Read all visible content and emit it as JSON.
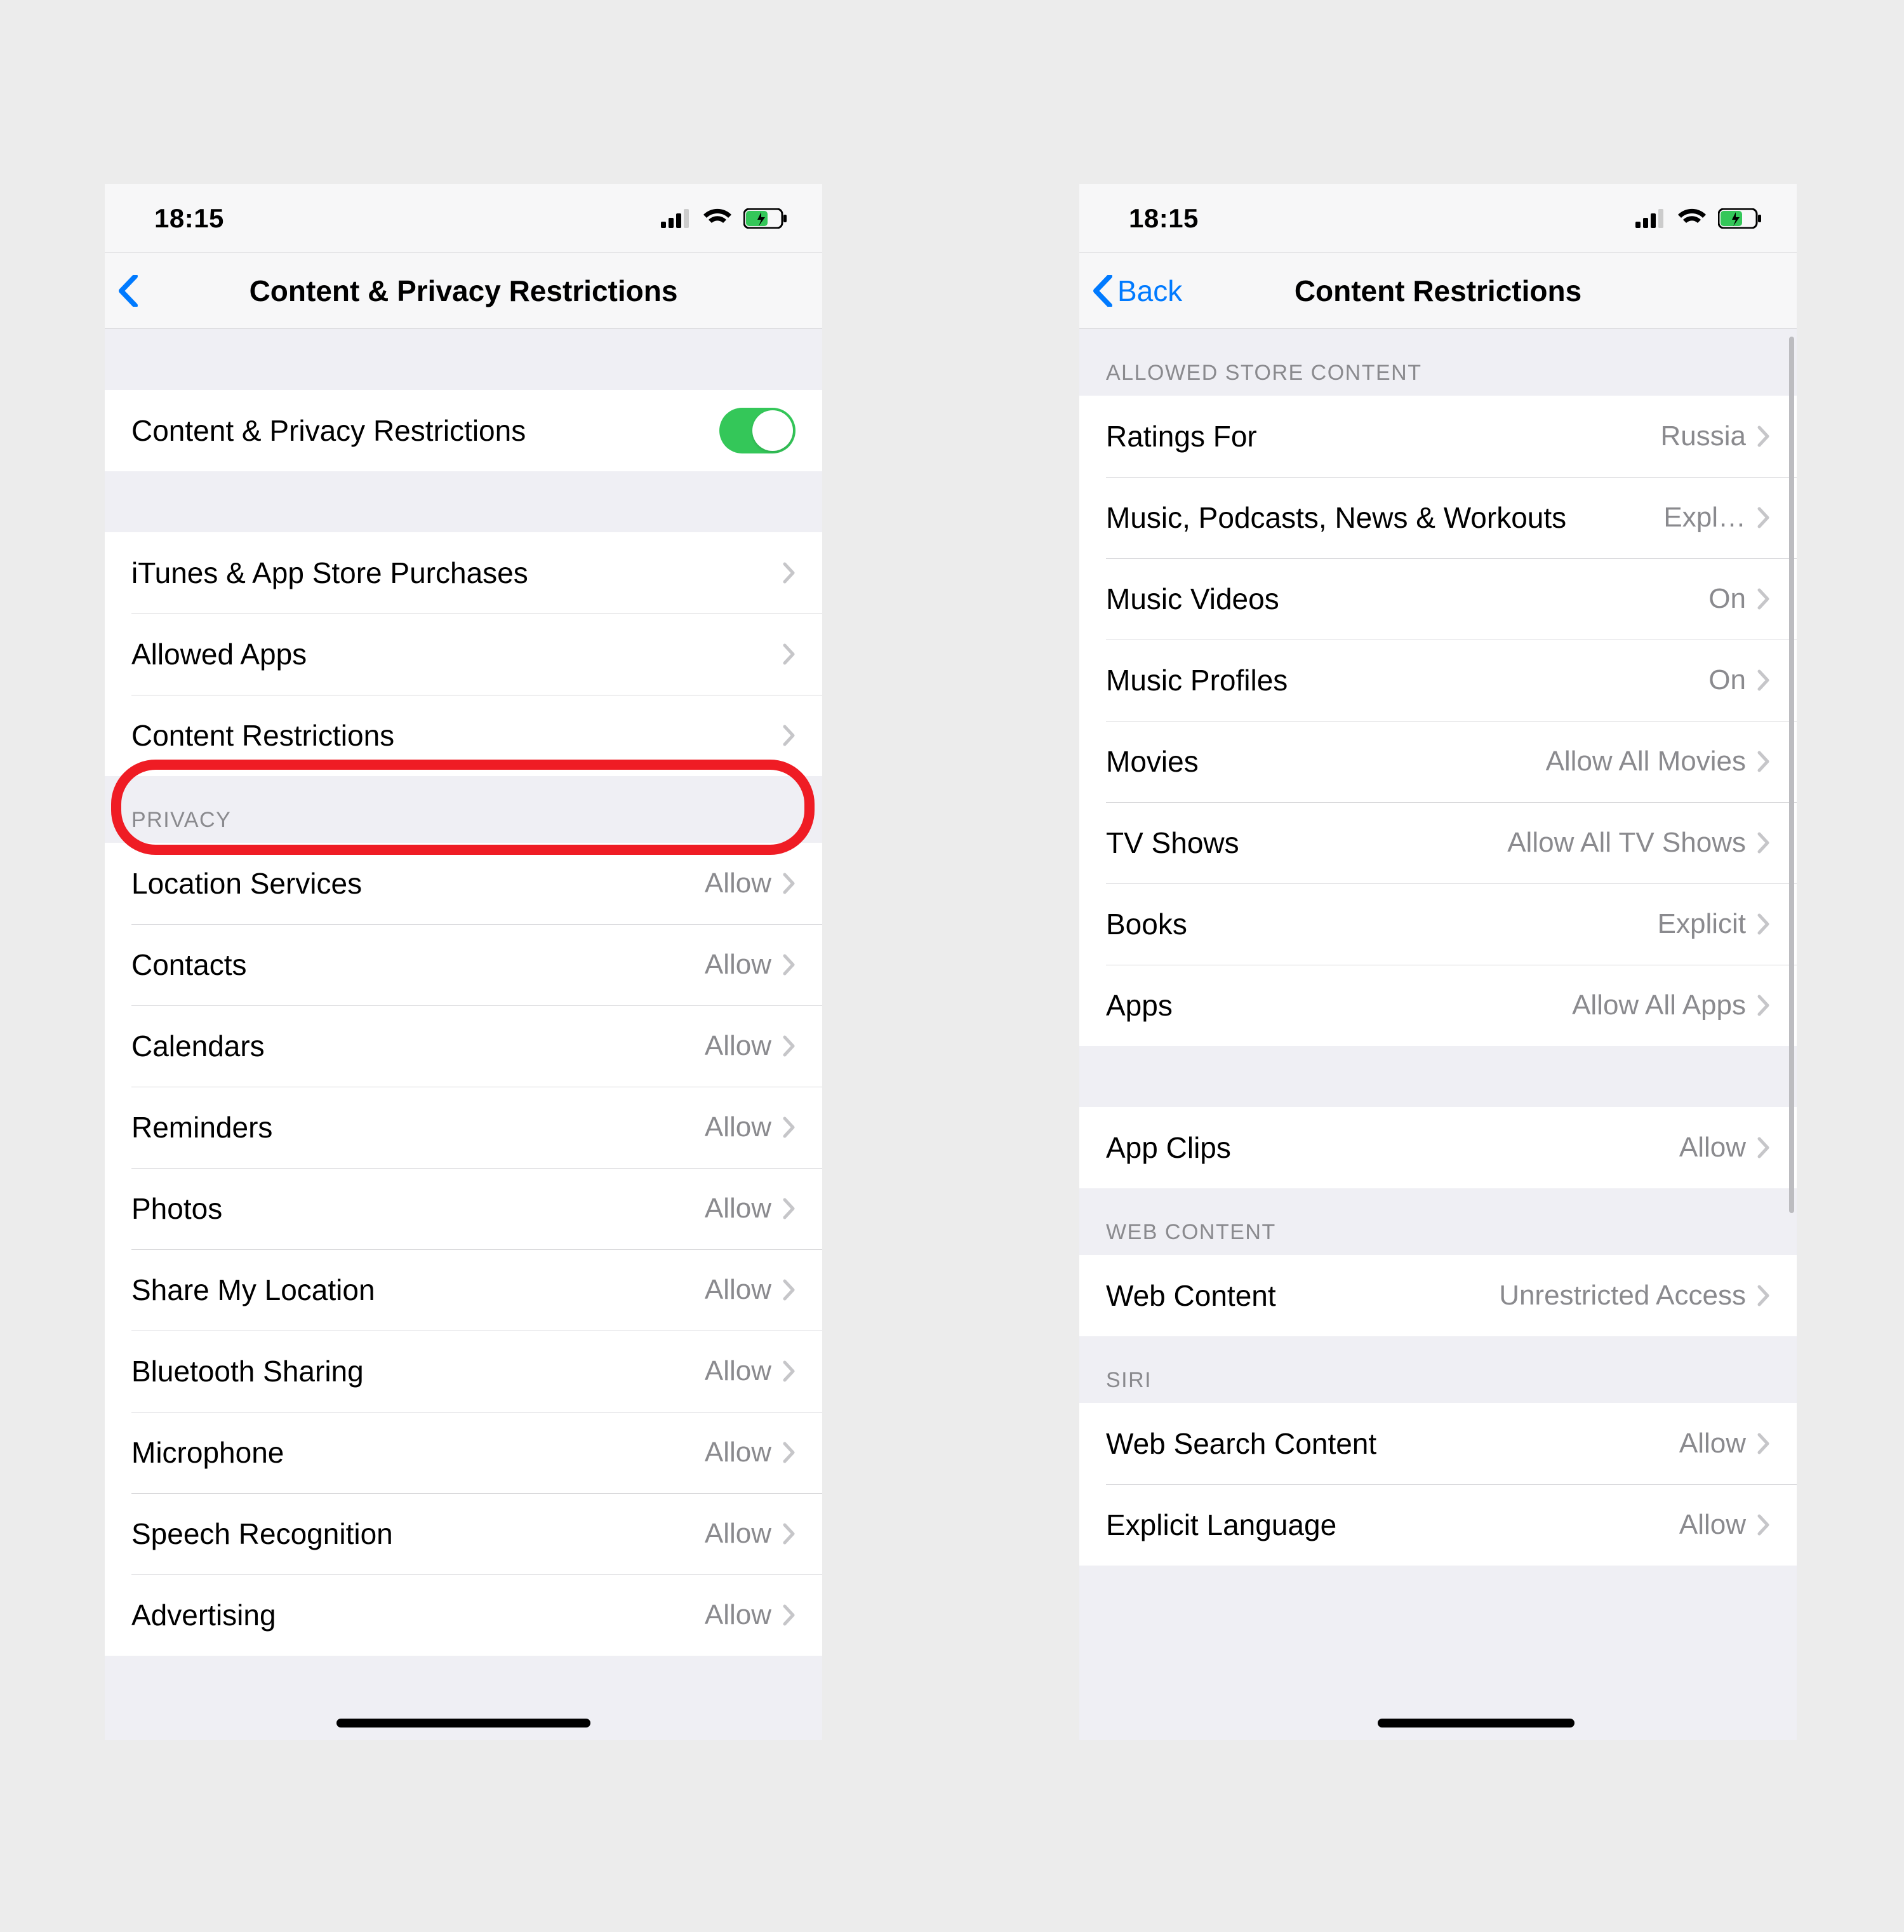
{
  "status": {
    "time": "18:15"
  },
  "left": {
    "nav": {
      "title": "Content & Privacy Restrictions"
    },
    "toggle_row": {
      "label": "Content & Privacy Restrictions",
      "on": true
    },
    "main_rows": [
      {
        "label": "iTunes & App Store Purchases"
      },
      {
        "label": "Allowed Apps"
      },
      {
        "label": "Content Restrictions"
      }
    ],
    "privacy_header": "Privacy",
    "privacy_rows": [
      {
        "label": "Location Services",
        "value": "Allow"
      },
      {
        "label": "Contacts",
        "value": "Allow"
      },
      {
        "label": "Calendars",
        "value": "Allow"
      },
      {
        "label": "Reminders",
        "value": "Allow"
      },
      {
        "label": "Photos",
        "value": "Allow"
      },
      {
        "label": "Share My Location",
        "value": "Allow"
      },
      {
        "label": "Bluetooth Sharing",
        "value": "Allow"
      },
      {
        "label": "Microphone",
        "value": "Allow"
      },
      {
        "label": "Speech Recognition",
        "value": "Allow"
      },
      {
        "label": "Advertising",
        "value": "Allow"
      }
    ]
  },
  "right": {
    "nav": {
      "back": "Back",
      "title": "Content Restrictions"
    },
    "store_header": "Allowed Store Content",
    "store_rows": [
      {
        "label": "Ratings For",
        "value": "Russia"
      },
      {
        "label": "Music, Podcasts, News & Workouts",
        "value": "Expl…"
      },
      {
        "label": "Music Videos",
        "value": "On"
      },
      {
        "label": "Music Profiles",
        "value": "On"
      },
      {
        "label": "Movies",
        "value": "Allow All Movies"
      },
      {
        "label": "TV Shows",
        "value": "Allow All TV Shows"
      },
      {
        "label": "Books",
        "value": "Explicit"
      },
      {
        "label": "Apps",
        "value": "Allow All Apps"
      }
    ],
    "appclips_row": {
      "label": "App Clips",
      "value": "Allow"
    },
    "web_header": "Web Content",
    "web_row": {
      "label": "Web Content",
      "value": "Unrestricted Access"
    },
    "siri_header": "Siri",
    "siri_rows": [
      {
        "label": "Web Search Content",
        "value": "Allow"
      },
      {
        "label": "Explicit Language",
        "value": "Allow"
      }
    ]
  }
}
